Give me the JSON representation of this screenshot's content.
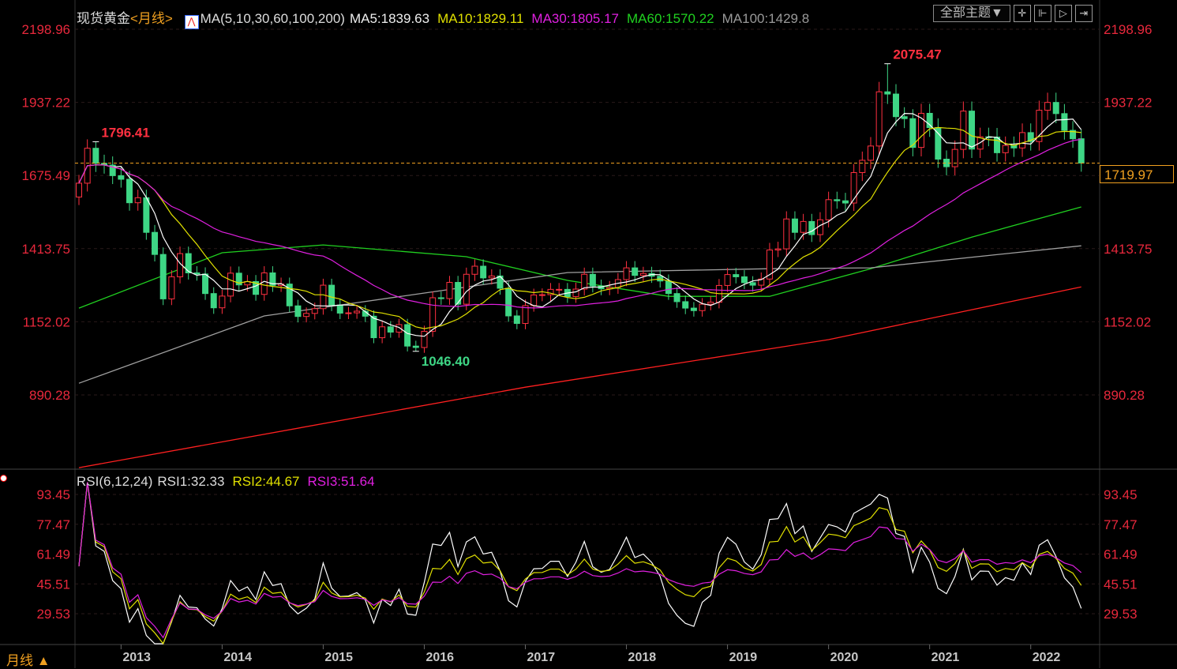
{
  "header": {
    "symbol": "现货黄金",
    "period_tag": "<月线>",
    "ma_label": "MA(5,10,30,60,100,200)",
    "ma5": "MA5:1839.63",
    "ma10": "MA10:1829.11",
    "ma30": "MA30:1805.17",
    "ma60": "MA60:1570.22",
    "ma100": "MA100:1429.8"
  },
  "toolbar": {
    "theme_button": "全部主题▼",
    "icons": [
      "crosshair-icon",
      "zoom-range-icon",
      "play-icon",
      "exit-right-icon"
    ]
  },
  "rsi_header": {
    "label": "RSI(6,12,24)",
    "rsi1": "RSI1:32.33",
    "rsi2": "RSI2:44.67",
    "rsi3": "RSI3:51.64"
  },
  "period_button": "月线 ▲",
  "current_price": "1719.97",
  "colors": {
    "up": "#ff3040",
    "down": "#3ed685",
    "ma5": "#ffffff",
    "ma10": "#e0e000",
    "ma30": "#e020e0",
    "ma60": "#20d020",
    "ma100": "#a0a0a0",
    "ma200": "#ff2020",
    "axis": "#e8283c"
  },
  "chart_data": {
    "type": "candlestick",
    "title": "现货黄金 月线",
    "start": "2012-08",
    "price_axis": {
      "ticks": [
        "2198.96",
        "1937.22",
        "1675.49",
        "1413.75",
        "1152.02",
        "890.28"
      ],
      "range": [
        890.28,
        2198.96
      ]
    },
    "rsi_axis": {
      "ticks": [
        "93.45",
        "77.47",
        "61.49",
        "45.51",
        "29.53"
      ],
      "range": [
        29.53,
        93.45
      ]
    },
    "x_ticks": [
      "2013",
      "2014",
      "2015",
      "2016",
      "2017",
      "2018",
      "2019",
      "2020",
      "2021",
      "2022"
    ],
    "closes": [
      1648,
      1773,
      1719,
      1713,
      1675,
      1662,
      1578,
      1596,
      1472,
      1393,
      1234,
      1313,
      1396,
      1327,
      1323,
      1253,
      1202,
      1244,
      1326,
      1284,
      1296,
      1250,
      1327,
      1282,
      1287,
      1209,
      1171,
      1182,
      1199,
      1283,
      1212,
      1183,
      1184,
      1190,
      1172,
      1095,
      1134,
      1115,
      1142,
      1065,
      1060,
      1118,
      1238,
      1235,
      1293,
      1215,
      1322,
      1351,
      1309,
      1316,
      1272,
      1173,
      1146,
      1210,
      1248,
      1249,
      1268,
      1268,
      1242,
      1269,
      1322,
      1280,
      1270,
      1275,
      1303,
      1345,
      1318,
      1325,
      1315,
      1298,
      1253,
      1224,
      1201,
      1192,
      1215,
      1222,
      1282,
      1321,
      1313,
      1292,
      1283,
      1305,
      1409,
      1413,
      1520,
      1472,
      1511,
      1464,
      1517,
      1589,
      1585,
      1577,
      1686,
      1730,
      1781,
      1975,
      1967,
      1886,
      1879,
      1776,
      1898,
      1847,
      1734,
      1707,
      1769,
      1906,
      1770,
      1814,
      1813,
      1757,
      1783,
      1774,
      1829,
      1797,
      1909,
      1937,
      1897,
      1837,
      1807,
      1720
    ],
    "annotations": [
      {
        "label": "1796.41",
        "index": 2,
        "type": "high"
      },
      {
        "label": "1046.40",
        "index": 40,
        "type": "low"
      },
      {
        "label": "2075.47",
        "index": 96,
        "type": "high"
      }
    ],
    "ma_long": {
      "MA60": [
        [
          "2012-08",
          1201
        ],
        [
          "2014-01",
          1399
        ],
        [
          "2015-01",
          1427
        ],
        [
          "2016-06",
          1385
        ],
        [
          "2017-06",
          1300
        ],
        [
          "2018-06",
          1243
        ],
        [
          "2019-06",
          1243
        ],
        [
          "2020-06",
          1342
        ],
        [
          "2021-06",
          1455
        ],
        [
          "2022-07",
          1563
        ]
      ],
      "MA100": [
        [
          "2012-08",
          932
        ],
        [
          "2014-06",
          1173
        ],
        [
          "2017-06",
          1328
        ],
        [
          "2019-06",
          1342
        ],
        [
          "2020-06",
          1345
        ],
        [
          "2022-07",
          1424
        ]
      ],
      "MA200": [
        [
          "2012-08",
          630
        ],
        [
          "2017-01",
          918
        ],
        [
          "2020-01",
          1088
        ],
        [
          "2022-07",
          1277
        ]
      ]
    }
  }
}
